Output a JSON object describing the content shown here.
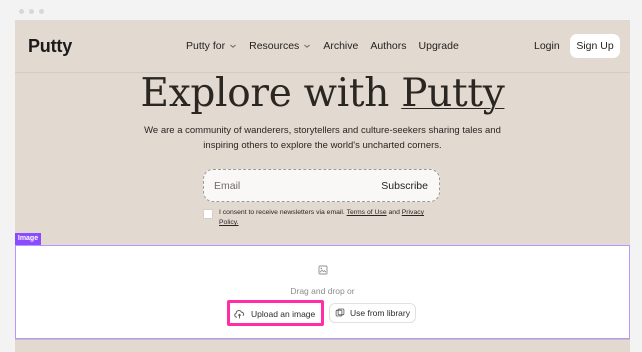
{
  "nav": {
    "logo": "Putty",
    "items": [
      {
        "label": "Putty for",
        "has_dropdown": true
      },
      {
        "label": "Resources",
        "has_dropdown": true
      },
      {
        "label": "Archive",
        "has_dropdown": false
      },
      {
        "label": "Authors",
        "has_dropdown": false
      },
      {
        "label": "Upgrade",
        "has_dropdown": false
      }
    ],
    "login": "Login",
    "signup": "Sign Up"
  },
  "hero": {
    "title_prefix": "Explore with",
    "title_brand": "Putty",
    "description": "We are a community of wanderers, storytellers and culture-seekers sharing tales and inspiring others to explore the world's uncharted corners."
  },
  "signup_form": {
    "email_placeholder": "Email",
    "subscribe_label": "Subscribe",
    "consent_text_before": "I consent to receive newsletters via email.",
    "terms_link": "Terms of Use",
    "consent_text_middle": "and",
    "privacy_link": "Privacy Policy."
  },
  "image_block": {
    "tag": "Image",
    "drag_text": "Drag and drop or",
    "upload_label": "Upload an image",
    "library_label": "Use from library",
    "placeholder_icon": "image-icon",
    "upload_icon": "upload-icon",
    "library_icon": "library-icon"
  },
  "colors": {
    "page_bg": "#e2d9d0",
    "accent_purple": "#8b4cff",
    "selection_border": "#b895ff",
    "highlight_pink": "#ff2ea6"
  }
}
